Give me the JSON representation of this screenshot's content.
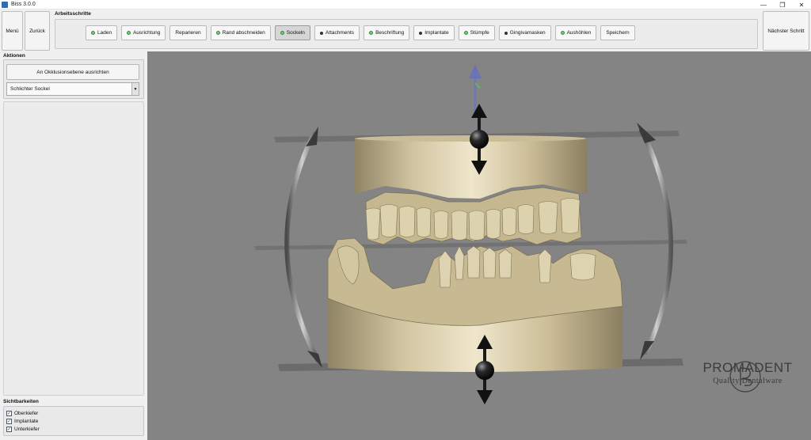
{
  "window": {
    "title": "Biss 3.0.0",
    "icon": "app-icon",
    "minimize": "—",
    "maximize": "❐",
    "close": "✕"
  },
  "toolbar": {
    "menu_label": "Menü",
    "back_label": "Zurück",
    "steps_title": "Arbeitsschritte",
    "next_label": "Nächster Schritt",
    "steps": [
      {
        "label": "Laden",
        "icon": "green-dot"
      },
      {
        "label": "Ausrichtung",
        "icon": "green-dot"
      },
      {
        "label": "Reparieren",
        "icon": ""
      },
      {
        "label": "Rand abschneiden",
        "icon": "green-dot"
      },
      {
        "label": "Sockeln",
        "icon": "green-dot",
        "active": true
      },
      {
        "label": "Attachments",
        "icon": "dark-dot"
      },
      {
        "label": "Beschriftung",
        "icon": "green-dot"
      },
      {
        "label": "Implantate",
        "icon": "dark-dot"
      },
      {
        "label": "Stümpfe",
        "icon": "green-dot"
      },
      {
        "label": "Gingivamasken",
        "icon": "dark-dot"
      },
      {
        "label": "Aushöhlen",
        "icon": "green-dot"
      },
      {
        "label": "Speichern",
        "icon": ""
      }
    ]
  },
  "actions": {
    "title": "Aktionen",
    "align_button": "An Okklusionsebene ausrichten",
    "base_select": {
      "value": "Schlichter Sockel",
      "arrow": "▼"
    }
  },
  "visibility": {
    "title": "Sichtbarkeiten",
    "items": [
      {
        "label": "Oberkiefer",
        "checked": true
      },
      {
        "label": "Implantate",
        "checked": true
      },
      {
        "label": "Unterkiefer",
        "checked": true
      }
    ],
    "check_glyph": "✓"
  },
  "logo": {
    "title": "PROMADENT",
    "subtitle": "Quality Dentalware"
  },
  "colors": {
    "viewport_bg": "#848484",
    "model": "#c9bc98",
    "accent_green": "#7cc57c"
  }
}
